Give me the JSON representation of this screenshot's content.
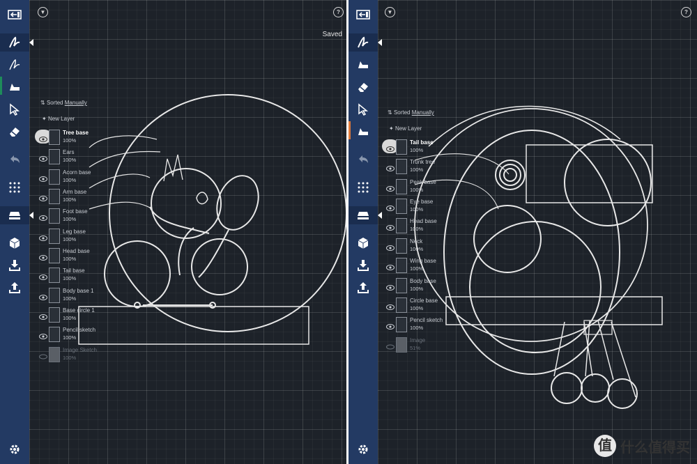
{
  "left": {
    "status": "Saved",
    "sort_prefix": "Sorted",
    "sort_mode": "Manually",
    "new_layer": "New Layer",
    "layers": [
      {
        "name": "Tree base",
        "opacity": "100%"
      },
      {
        "name": "Ears",
        "opacity": "100%"
      },
      {
        "name": "Acorn base",
        "opacity": "100%"
      },
      {
        "name": "Arm base",
        "opacity": "100%"
      },
      {
        "name": "Foot base",
        "opacity": "100%"
      },
      {
        "name": "Leg base",
        "opacity": "100%"
      },
      {
        "name": "Head base",
        "opacity": "100%"
      },
      {
        "name": "Tail base",
        "opacity": "100%"
      },
      {
        "name": "Body base 1",
        "opacity": "100%"
      },
      {
        "name": "Base circle 1",
        "opacity": "100%"
      },
      {
        "name": "Pencil sketch",
        "opacity": "100%"
      },
      {
        "name": "Image Sketch",
        "opacity": "100%"
      }
    ]
  },
  "right": {
    "sort_prefix": "Sorted",
    "sort_mode": "Manually",
    "new_layer": "New Layer",
    "layers": [
      {
        "name": "Tail base",
        "opacity": "100%"
      },
      {
        "name": "Trunk tree",
        "opacity": "100%"
      },
      {
        "name": "Peak base",
        "opacity": "100%"
      },
      {
        "name": "Eye base",
        "opacity": "100%"
      },
      {
        "name": "Head base",
        "opacity": "100%"
      },
      {
        "name": "Neck",
        "opacity": "100%"
      },
      {
        "name": "Wing base",
        "opacity": "100%"
      },
      {
        "name": "Body base",
        "opacity": "100%"
      },
      {
        "name": "Circle base",
        "opacity": "100%"
      },
      {
        "name": "Pencil sketch",
        "opacity": "100%"
      },
      {
        "name": "Image",
        "opacity": "51%"
      }
    ]
  },
  "watermark": {
    "logo": "值",
    "text": "什么值得买"
  },
  "colors": {
    "canvas": "#1d2229",
    "toolbar": "#233a63",
    "accent_green": "#1e8c5a",
    "accent_orange": "#e07a3a"
  },
  "icons": [
    "exit-icon",
    "menu-down-icon",
    "help-icon",
    "pencil-icon",
    "pen-icon",
    "brush-icon",
    "select-icon",
    "eraser-icon",
    "undo-icon",
    "grid-icon",
    "layers-icon",
    "shape-icon",
    "import-icon",
    "export-icon",
    "settings-icon"
  ]
}
